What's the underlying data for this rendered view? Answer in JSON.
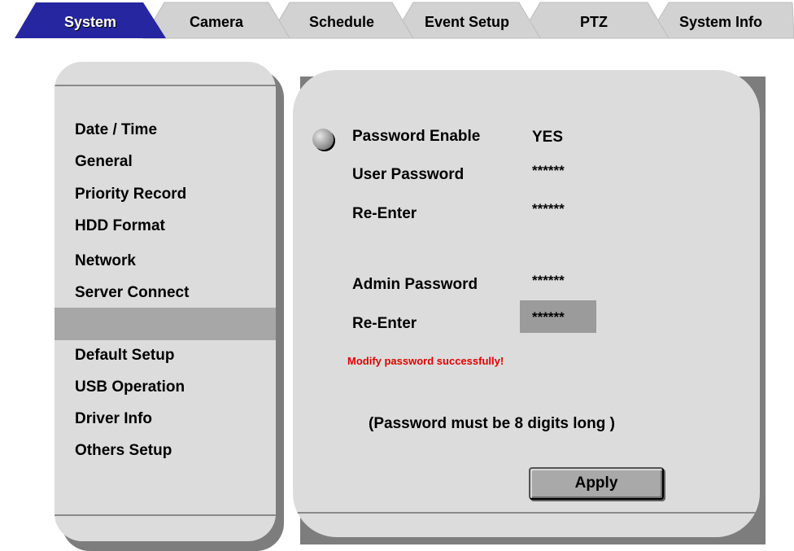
{
  "tabs": [
    {
      "label": "System",
      "active": true
    },
    {
      "label": "Camera",
      "active": false
    },
    {
      "label": "Schedule",
      "active": false
    },
    {
      "label": "Event Setup",
      "active": false
    },
    {
      "label": "PTZ",
      "active": false
    },
    {
      "label": "System Info",
      "active": false
    }
  ],
  "menu": {
    "items": [
      {
        "label": "Date / Time"
      },
      {
        "label": "General"
      },
      {
        "label": "Priority Record"
      },
      {
        "label": "HDD Format"
      },
      {
        "label": "Network"
      },
      {
        "label": "Server Connect"
      },
      {
        "label": ""
      },
      {
        "label": "Default Setup"
      },
      {
        "label": "USB Operation"
      },
      {
        "label": "Driver Info"
      },
      {
        "label": "Others Setup"
      }
    ],
    "selected_index": 6
  },
  "settings": {
    "password_enable": {
      "label": "Password Enable",
      "value": "YES"
    },
    "user_password": {
      "label": "User Password",
      "value": "******"
    },
    "user_reenter": {
      "label": "Re-Enter",
      "value": "******"
    },
    "admin_password": {
      "label": "Admin Password",
      "value": "******"
    },
    "admin_reenter": {
      "label": "Re-Enter",
      "value": "******"
    },
    "message": "Modify password successfully!",
    "hint": "(Password must be 8 digits long )",
    "apply_label": "Apply"
  },
  "colors": {
    "active_tab": "#2626a0",
    "inactive_tab": "#d2d2d2",
    "panel": "#dcdcdc",
    "highlight": "#a7a7a7",
    "message": "#e00000"
  }
}
